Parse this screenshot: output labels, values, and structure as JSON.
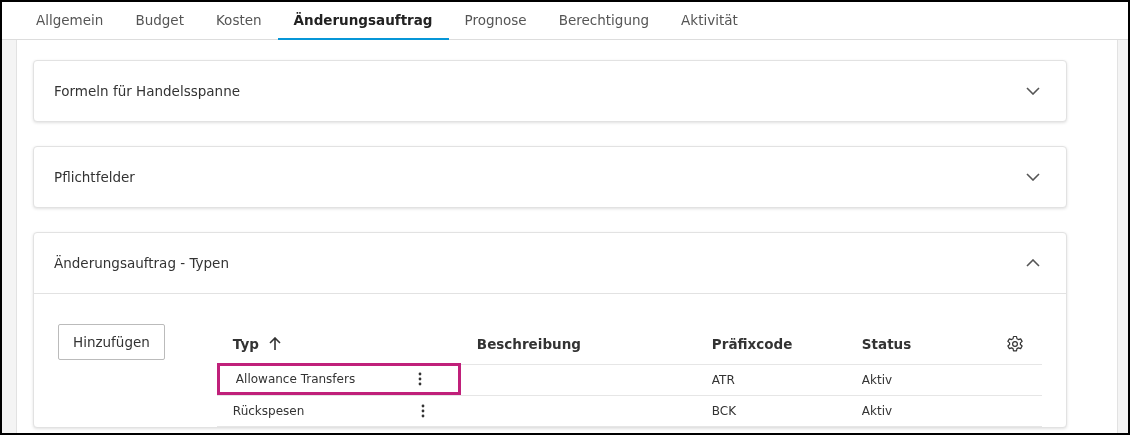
{
  "tabs": [
    {
      "label": "Allgemein",
      "selected": false
    },
    {
      "label": "Budget",
      "selected": false
    },
    {
      "label": "Kosten",
      "selected": false
    },
    {
      "label": "Änderungsauftrag",
      "selected": true
    },
    {
      "label": "Prognose",
      "selected": false
    },
    {
      "label": "Berechtigung",
      "selected": false
    },
    {
      "label": "Aktivität",
      "selected": false
    }
  ],
  "panels": [
    {
      "title": "Formeln für Handelsspanne",
      "expanded": false
    },
    {
      "title": "Pflichtfelder",
      "expanded": false
    },
    {
      "title": "Änderungsauftrag - Typen",
      "expanded": true
    }
  ],
  "add_button": "Hinzufügen",
  "table": {
    "columns": [
      "Typ",
      "Beschreibung",
      "Präfixcode",
      "Status"
    ],
    "rows": [
      {
        "cells": [
          "Allowance Transfers",
          "",
          "ATR",
          "Aktiv"
        ],
        "highlighted": true
      },
      {
        "cells": [
          "Rückspesen",
          "",
          "BCK",
          "Aktiv"
        ],
        "highlighted": false
      }
    ]
  }
}
